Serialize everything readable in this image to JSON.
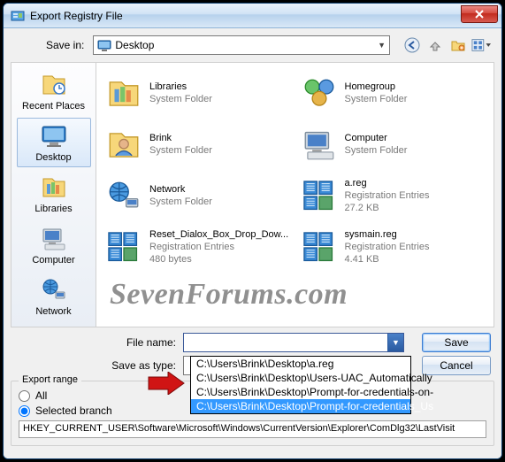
{
  "window": {
    "title": "Export Registry File"
  },
  "topbar": {
    "save_in_label": "Save in:",
    "location": "Desktop",
    "icons": [
      "back-icon",
      "up-icon",
      "new-folder-icon",
      "view-menu-icon"
    ]
  },
  "places": [
    {
      "label": "Recent Places",
      "icon": "recent"
    },
    {
      "label": "Desktop",
      "icon": "desktop",
      "selected": true
    },
    {
      "label": "Libraries",
      "icon": "libraries"
    },
    {
      "label": "Computer",
      "icon": "computer"
    },
    {
      "label": "Network",
      "icon": "network"
    }
  ],
  "files": [
    {
      "name": "Libraries",
      "meta1": "System Folder",
      "icon": "libraries"
    },
    {
      "name": "Homegroup",
      "meta1": "System Folder",
      "icon": "homegroup"
    },
    {
      "name": "Brink",
      "meta1": "System Folder",
      "icon": "user"
    },
    {
      "name": "Computer",
      "meta1": "System Folder",
      "icon": "computer"
    },
    {
      "name": "Network",
      "meta1": "System Folder",
      "icon": "network"
    },
    {
      "name": "a.reg",
      "meta1": "Registration Entries",
      "meta2": "27.2 KB",
      "icon": "reg"
    },
    {
      "name": "Reset_Dialox_Box_Drop_Dow...",
      "meta1": "Registration Entries",
      "meta2": "480 bytes",
      "icon": "reg"
    },
    {
      "name": "sysmain.reg",
      "meta1": "Registration Entries",
      "meta2": "4.41 KB",
      "icon": "reg"
    }
  ],
  "form": {
    "filename_label": "File name:",
    "saveastype_label": "Save as type:",
    "filename_value": "",
    "saveastype_value": ""
  },
  "dropdown": {
    "options": [
      "C:\\Users\\Brink\\Desktop\\a.reg",
      "C:\\Users\\Brink\\Desktop\\Users-UAC_Automatically",
      "C:\\Users\\Brink\\Desktop\\Prompt-for-credentials-on-",
      "C:\\Users\\Brink\\Desktop\\Prompt-for-credentials_Us"
    ],
    "selected_index": 3
  },
  "buttons": {
    "save": "Save",
    "cancel": "Cancel"
  },
  "export_range": {
    "legend": "Export range",
    "all_label": "All",
    "selected_label": "Selected branch",
    "value": "selected",
    "branch_path": "HKEY_CURRENT_USER\\Software\\Microsoft\\Windows\\CurrentVersion\\Explorer\\ComDlg32\\LastVisit"
  },
  "watermark": "SevenForums.com"
}
